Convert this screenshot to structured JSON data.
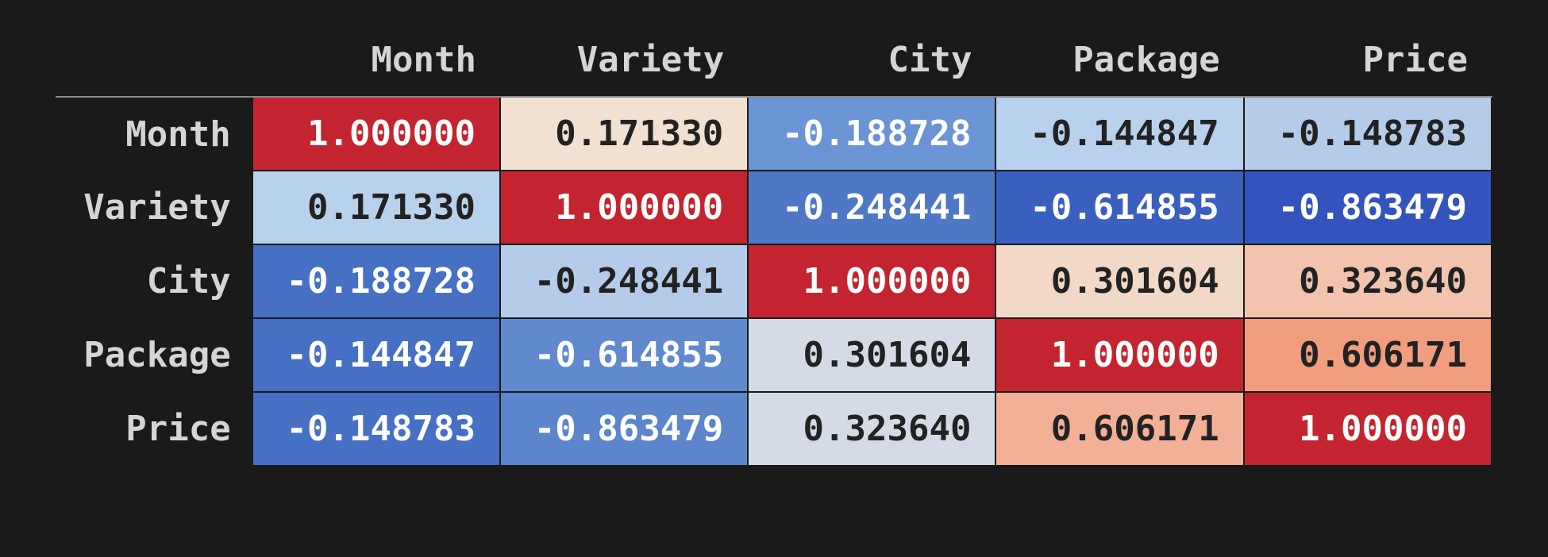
{
  "labels": [
    "Month",
    "Variety",
    "City",
    "Package",
    "Price"
  ],
  "cells": [
    [
      {
        "v": "1.000000",
        "bg": "#c4242f",
        "fg": "#ffffff"
      },
      {
        "v": "0.171330",
        "bg": "#f2e0d0",
        "fg": "#222222"
      },
      {
        "v": "-0.188728",
        "bg": "#6a94d3",
        "fg": "#ffffff"
      },
      {
        "v": "-0.144847",
        "bg": "#b8d1ed",
        "fg": "#222222"
      },
      {
        "v": "-0.148783",
        "bg": "#b4cce9",
        "fg": "#222222"
      }
    ],
    [
      {
        "v": "0.171330",
        "bg": "#b8d1ed",
        "fg": "#222222"
      },
      {
        "v": "1.000000",
        "bg": "#c4242f",
        "fg": "#ffffff"
      },
      {
        "v": "-0.248441",
        "bg": "#4e78c6",
        "fg": "#ffffff"
      },
      {
        "v": "-0.614855",
        "bg": "#3a5fc1",
        "fg": "#ffffff"
      },
      {
        "v": "-0.863479",
        "bg": "#3353bd",
        "fg": "#ffffff"
      }
    ],
    [
      {
        "v": "-0.188728",
        "bg": "#4570c3",
        "fg": "#ffffff"
      },
      {
        "v": "-0.248441",
        "bg": "#b4cce9",
        "fg": "#222222"
      },
      {
        "v": "1.000000",
        "bg": "#c4242f",
        "fg": "#ffffff"
      },
      {
        "v": "0.301604",
        "bg": "#f2d9c7",
        "fg": "#222222"
      },
      {
        "v": "0.323640",
        "bg": "#f2c4ad",
        "fg": "#222222"
      }
    ],
    [
      {
        "v": "-0.144847",
        "bg": "#4570c3",
        "fg": "#ffffff"
      },
      {
        "v": "-0.614855",
        "bg": "#6189ce",
        "fg": "#ffffff"
      },
      {
        "v": "0.301604",
        "bg": "#d4dbe6",
        "fg": "#222222"
      },
      {
        "v": "1.000000",
        "bg": "#c4242f",
        "fg": "#ffffff"
      },
      {
        "v": "0.606171",
        "bg": "#f09e7e",
        "fg": "#222222"
      }
    ],
    [
      {
        "v": "-0.148783",
        "bg": "#4570c3",
        "fg": "#ffffff"
      },
      {
        "v": "-0.863479",
        "bg": "#5d85cc",
        "fg": "#ffffff"
      },
      {
        "v": "0.323640",
        "bg": "#d4dbe6",
        "fg": "#222222"
      },
      {
        "v": "0.606171",
        "bg": "#f2b096",
        "fg": "#222222"
      },
      {
        "v": "1.000000",
        "bg": "#c4242f",
        "fg": "#ffffff"
      }
    ]
  ],
  "chart_data": {
    "type": "heatmap",
    "title": "",
    "row_labels": [
      "Month",
      "Variety",
      "City",
      "Package",
      "Price"
    ],
    "col_labels": [
      "Month",
      "Variety",
      "City",
      "Package",
      "Price"
    ],
    "values": [
      [
        1.0,
        0.17133,
        -0.188728,
        -0.144847,
        -0.148783
      ],
      [
        0.17133,
        1.0,
        -0.248441,
        -0.614855,
        -0.863479
      ],
      [
        -0.188728,
        -0.248441,
        1.0,
        0.301604,
        0.32364
      ],
      [
        -0.144847,
        -0.614855,
        0.301604,
        1.0,
        0.606171
      ],
      [
        -0.148783,
        -0.863479,
        0.32364,
        0.606171,
        1.0
      ]
    ],
    "value_range": [
      -1,
      1
    ],
    "colormap": "coolwarm"
  }
}
